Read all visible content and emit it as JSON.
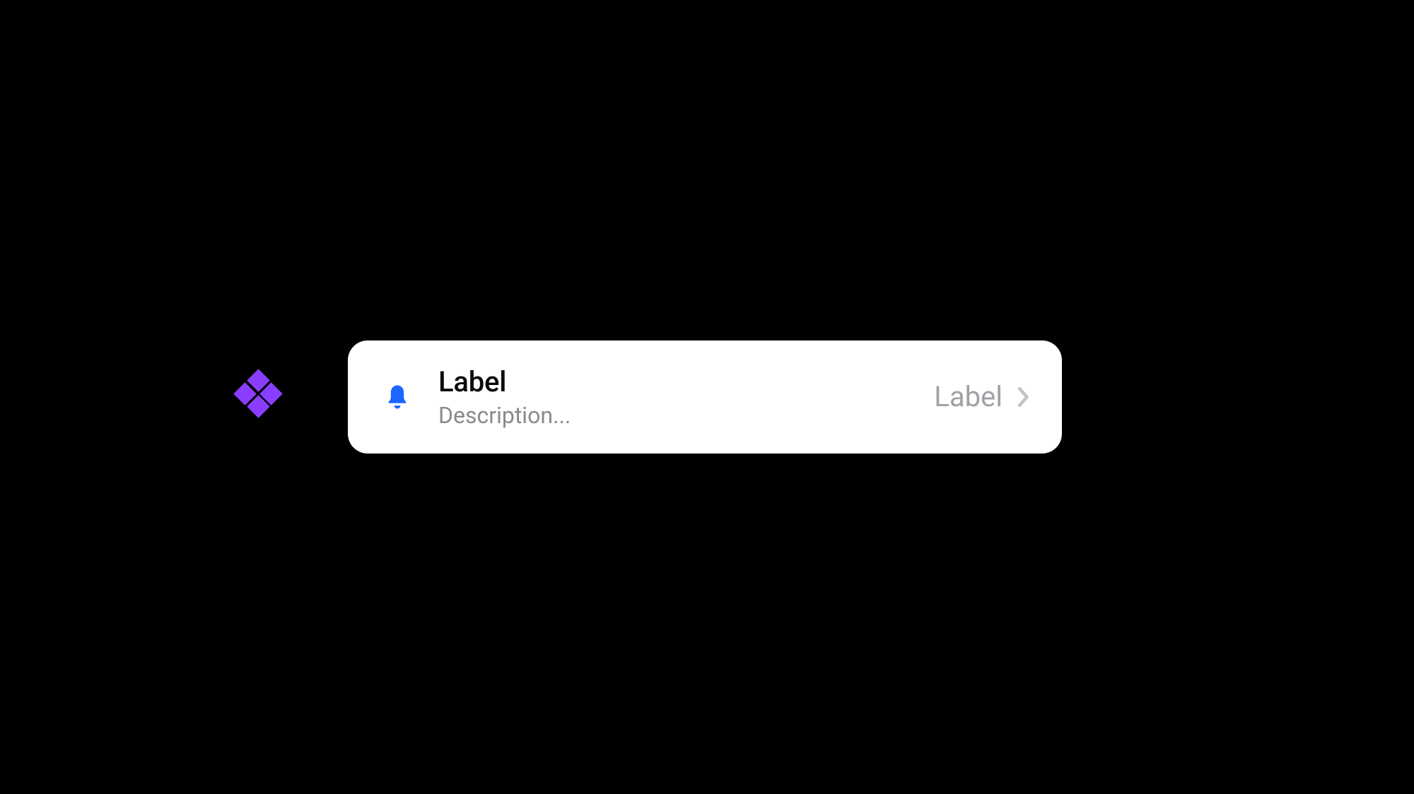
{
  "row": {
    "title": "Label",
    "description": "Description...",
    "trailing_label": "Label",
    "icon_name": "bell",
    "icon_color": "#1e66ff",
    "chevron_color": "#c4c4c8"
  },
  "logo": {
    "name": "diamond-logo",
    "color": "#8b3dff"
  }
}
